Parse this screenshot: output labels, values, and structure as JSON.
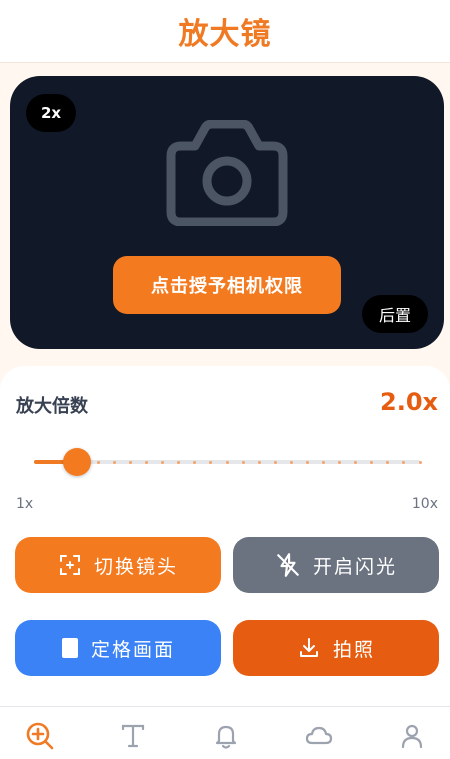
{
  "header": {
    "title": "放大镜"
  },
  "camera": {
    "zoom_badge": "2x",
    "grant_button": "点击授予相机权限",
    "rear_button": "后置"
  },
  "zoom": {
    "label": "放大倍数",
    "value_text": "2.0x",
    "value": 2.0,
    "min": 1,
    "max": 10,
    "min_label": "1x",
    "max_label": "10x"
  },
  "actions": {
    "switch_lens": "切换镜头",
    "flash": "开启闪光",
    "freeze": "定格画面",
    "photo": "拍照"
  },
  "nav": {
    "items": [
      {
        "icon": "magnifier-plus-icon",
        "active": true
      },
      {
        "icon": "text-icon",
        "active": false
      },
      {
        "icon": "bell-icon",
        "active": false
      },
      {
        "icon": "cloud-icon",
        "active": false
      },
      {
        "icon": "user-icon",
        "active": false
      }
    ]
  },
  "colors": {
    "accent": "#F07A24",
    "accent_dark": "#E65C10",
    "camera_bg": "#111827",
    "gray_button": "#6B7280",
    "blue_button": "#3B82F6",
    "nav_inactive": "#9CA3AF"
  }
}
